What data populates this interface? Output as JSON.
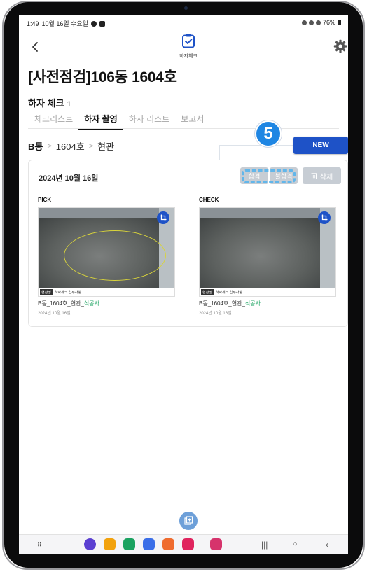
{
  "status_bar": {
    "time": "1:49",
    "date": "10월 16일 수요일",
    "battery": "76%"
  },
  "app": {
    "label": "하자체크",
    "accent": "#1E52C7"
  },
  "header": {
    "title": "[사전점검]106동 1604호"
  },
  "section": {
    "title": "하자 체크",
    "count": "1"
  },
  "tabs": [
    {
      "label": "체크리스트",
      "active": false
    },
    {
      "label": "하자 촬영",
      "active": true
    },
    {
      "label": "하자 리스트",
      "active": false
    },
    {
      "label": "보고서",
      "active": false
    }
  ],
  "breadcrumb": {
    "building": "B동",
    "unit": "1604호",
    "room": "현관",
    "sep": ">"
  },
  "new_button": "NEW",
  "step_badge": "5",
  "card": {
    "date": "2024년 10월 16일",
    "pass_label": "합격",
    "fail_label": "불합격",
    "delete_label": "삭제",
    "panels": [
      {
        "header": "PICK",
        "photo_tag": "현관명",
        "photo_text": "하자체크 업무사항",
        "caption_main": "B동_1604호_현관_",
        "caption_accent": "석공사",
        "date": "2024년 10월 16일"
      },
      {
        "header": "CHECK",
        "photo_tag": "현관명",
        "photo_text": "하자체크 업무사항",
        "caption_main": "B동_1604호_현관_",
        "caption_accent": "석공사",
        "date": "2024년 10월 16일"
      }
    ]
  },
  "colors": {
    "primary_button": "#1E52C7",
    "badge": "#1F86E3",
    "disabled_pill": "#C7CDD4",
    "accent_text": "#28A86A"
  },
  "icons": [
    "back-arrow-icon",
    "clipboard-check-icon",
    "gear-icon",
    "crop-icon",
    "trash-icon",
    "add-photo-icon"
  ]
}
